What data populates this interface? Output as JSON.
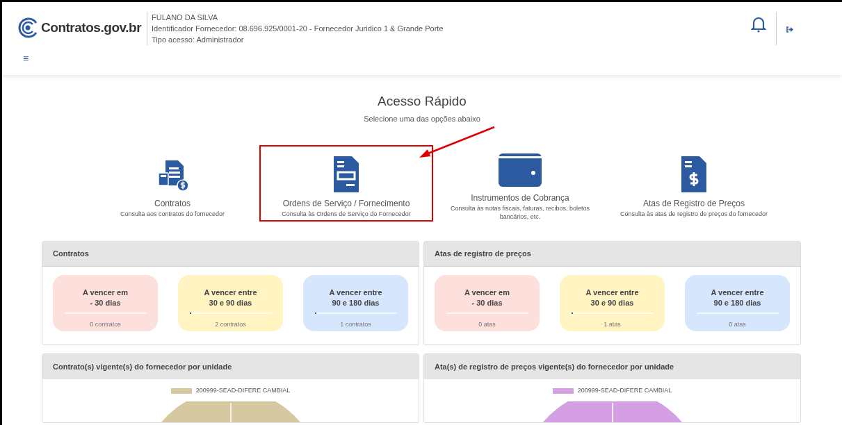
{
  "header": {
    "logo": "Contratos.gov.br",
    "user_name": "FULANO DA SILVA",
    "supplier_id": "Identificador Fornecedor: 08.696.925/0001-20 - Fornecedor Juridico 1 & Grande Porte",
    "access_type": "Tipo acesso: Administrador",
    "menu_glyph": "≡"
  },
  "quick_access": {
    "title": "Acesso Rápido",
    "subtitle": "Selecione uma das opções abaixo",
    "options": [
      {
        "kind": "contracts",
        "title": "Contratos",
        "description": "Consulta aos contratos do fornecedor",
        "highlighted": false
      },
      {
        "kind": "orders",
        "title": "Ordens de Serviço / Fornecimento",
        "description": "Consulta às Ordens de Serviço do Fornecedor",
        "highlighted": true
      },
      {
        "kind": "billing",
        "title": "Instrumentos de Cobrança",
        "description": "Consulta às notas fiscais, faturas, recibos, boletos bancários, etc.",
        "highlighted": false
      },
      {
        "kind": "price",
        "title": "Atas de Registro de Preços",
        "description": "Consulta às atas de registro de preços do fornecedor",
        "highlighted": false
      }
    ]
  },
  "summary_panels": [
    {
      "title": "Contratos",
      "cards": [
        {
          "color": "#fde0dc",
          "line_1": "A vencer em",
          "line_2": "- 30 dias",
          "count": "0 contratos"
        },
        {
          "color": "#fff4c2",
          "line_1": "A vencer entre",
          "line_2": "30 e 90 dias",
          "level": 0.01,
          "count": "2 contratos"
        },
        {
          "color": "#d6e6fd",
          "line_1": "A vencer entre",
          "line_2": "90 e 180 dias",
          "level": 0.01,
          "count": "1 contratos"
        }
      ]
    },
    {
      "title": "Atas de registro de preços",
      "cards": [
        {
          "color": "#fde0dc",
          "line_1": "A vencer em",
          "line_2": "- 30 dias",
          "count": "0 atas"
        },
        {
          "color": "#fff4c2",
          "line_1": "A vencer entre",
          "line_2": "30 e 90 dias",
          "level": 0.01,
          "count": "1 atas"
        },
        {
          "color": "#d6e6fd",
          "line_1": "A vencer entre",
          "line_2": "90 e 180 dias",
          "count": "0 atas"
        }
      ]
    }
  ],
  "unit_panels": [
    {
      "title": "Contrato(s) vigente(s) do fornecedor por unidade",
      "legend": "200999-SEAD-DIFERE CAMBIAL",
      "color": "#d6c8a0"
    },
    {
      "title": "Ata(s) de registro de preços vigente(s) do fornecedor por unidade",
      "legend": "200999-SEAD-DIFERE CAMBIAL",
      "color": "#d49fe3"
    }
  ]
}
